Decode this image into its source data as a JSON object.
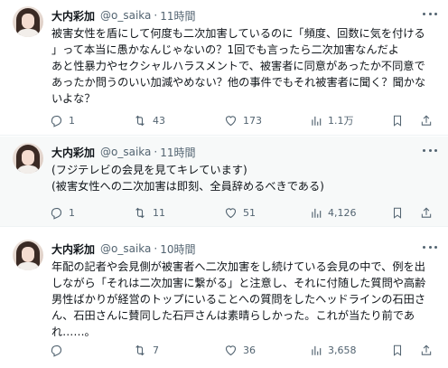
{
  "tweets": [
    {
      "name": "大内彩加",
      "handle": "@o_saika",
      "separator": "·",
      "time": "11時間",
      "lines": [
        "被害女性を盾にして何度も二次加害しているのに「頻度、回数に気を付ける",
        "」って本当に愚かなんじゃないの？1回でも言ったら二次加害なんだよ",
        "あと性暴力やセクシャルハラスメントで、被害者に同意があったか不同意で",
        "あったか問うのいい加減やめない？他の事件でもそれ被害者に聞く？聞かな",
        "いよな？"
      ],
      "replies": "1",
      "retweets": "43",
      "likes": "173",
      "views": "1.1万"
    },
    {
      "name": "大内彩加",
      "handle": "@o_saika",
      "separator": "·",
      "time": "11時間",
      "lines": [
        "(フジテレビの会見を見てキレています)",
        "(被害女性への二次加害は即刻、全員辞めるべきである)"
      ],
      "replies": "1",
      "retweets": "11",
      "likes": "51",
      "views": "4,126"
    },
    {
      "name": "大内彩加",
      "handle": "@o_saika",
      "separator": "·",
      "time": "10時間",
      "lines": [
        "年配の記者や会見側が被害者へ二次加害をし続けている会見の中で、例を出",
        "しながら「それは二次加害に繋がる」と注意し、それに付随した質問や高齢",
        "男性ばかりが経営のトップにいることへの質問をしたヘッドラインの石田さ",
        "ん、石田さんに賛同した石戸さんは素晴らしかった。これが当たり前であ",
        "れ……。"
      ],
      "replies": "",
      "retweets": "7",
      "likes": "36",
      "views": "3,658"
    }
  ],
  "icons": [
    "reply-icon",
    "retweet-icon",
    "like-icon",
    "views-icon",
    "bookmark-icon",
    "share-icon",
    "more-icon"
  ],
  "colors": {
    "text": "#0f1419",
    "secondary": "#536471",
    "highlight_bg": "#f7f9f9",
    "divider": "#eff3f4"
  }
}
